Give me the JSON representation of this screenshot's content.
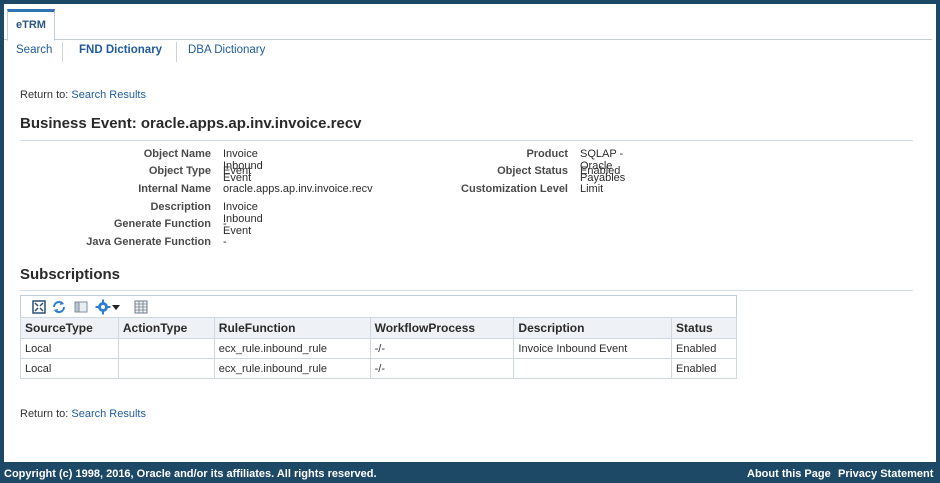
{
  "tabs": [
    {
      "label": "eTRM"
    }
  ],
  "subnav": [
    {
      "label": "Search"
    },
    {
      "label": "FND Dictionary"
    },
    {
      "label": "DBA Dictionary"
    }
  ],
  "return_prefix": "Return to:",
  "return_link": "Search Results",
  "page_title": "Business Event: oracle.apps.ap.inv.invoice.recv",
  "properties_left": [
    {
      "label": "Object Name",
      "value": "Invoice Inbound Event"
    },
    {
      "label": "Object Type",
      "value": "Event"
    },
    {
      "label": "Internal Name",
      "value": "oracle.apps.ap.inv.invoice.recv"
    },
    {
      "label": "Description",
      "value": "Invoice Inbound Event"
    },
    {
      "label": "Generate Function",
      "value": "-"
    },
    {
      "label": "Java Generate Function",
      "value": "-"
    }
  ],
  "properties_right": [
    {
      "label": "Product",
      "value": "SQLAP - Oracle Payables"
    },
    {
      "label": "Object Status",
      "value": "Enabled"
    },
    {
      "label": "Customization Level",
      "value": "Limit"
    }
  ],
  "subscriptions": {
    "title": "Subscriptions",
    "toolbar_icons": [
      "detach-icon",
      "refresh-icon",
      "freeze-icon",
      "gear-icon",
      "chevron-down-icon",
      "columns-icon"
    ],
    "columns": [
      "SourceType",
      "ActionType",
      "RuleFunction",
      "WorkflowProcess",
      "Description",
      "Status"
    ],
    "rows": [
      [
        "Local",
        "",
        "ecx_rule.inbound_rule",
        "-/-",
        "Invoice Inbound Event",
        "Enabled"
      ],
      [
        "Local",
        "",
        "ecx_rule.inbound_rule",
        "-/-",
        "",
        "Enabled"
      ]
    ]
  },
  "footer": {
    "copyright": "Copyright (c) 1998, 2016, Oracle and/or its affiliates. All rights reserved.",
    "about": "About this Page",
    "privacy": "Privacy Statement"
  },
  "colors": {
    "frame": "#1d4866",
    "link": "#1f5b9c",
    "tab_accent": "#2e74b5"
  }
}
